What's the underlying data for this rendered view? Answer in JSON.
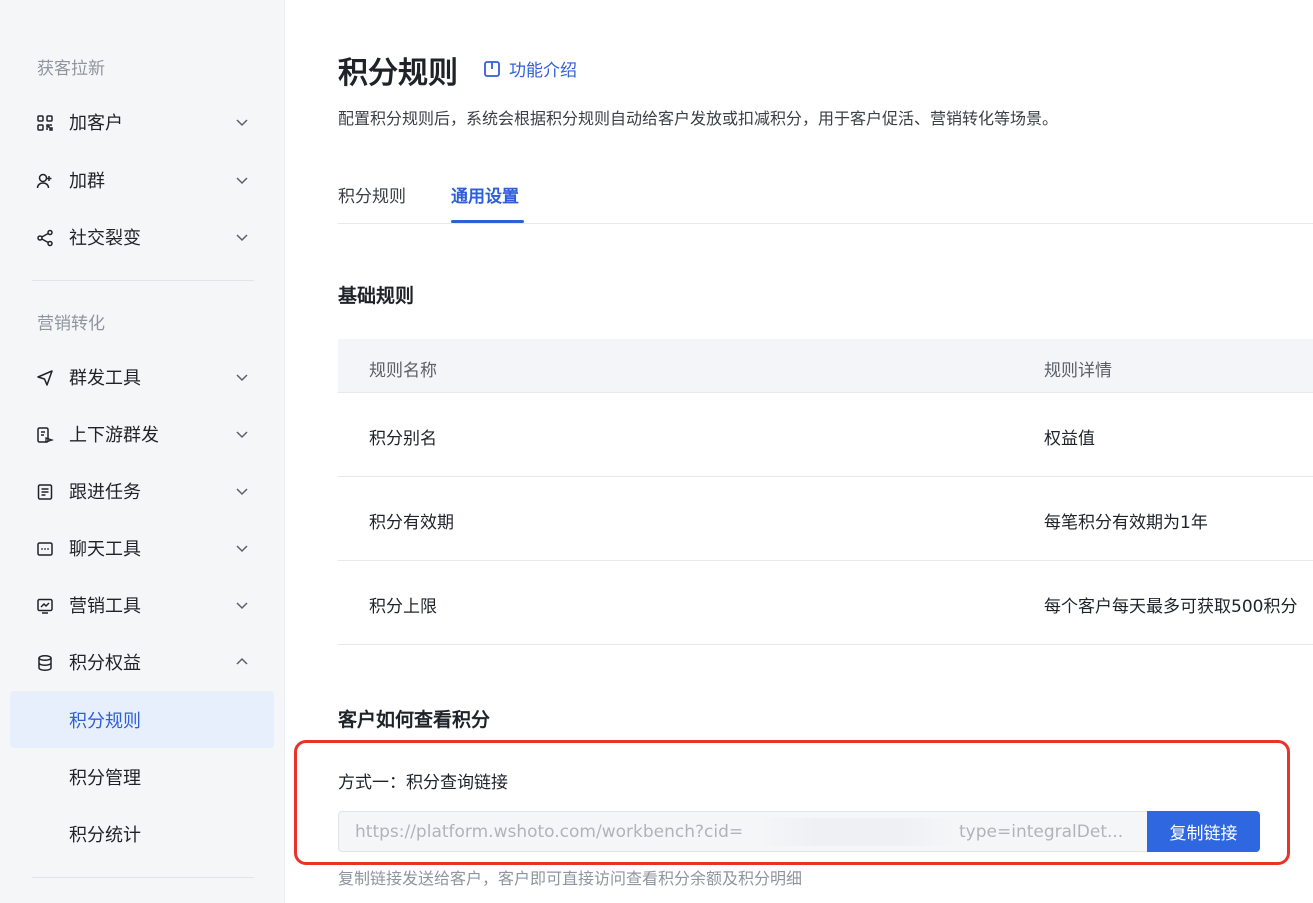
{
  "sidebar": {
    "section_acquire": "获客拉新",
    "section_marketing": "营销转化",
    "items": {
      "add_customer": "加客户",
      "add_group": "加群",
      "social_fission": "社交裂变",
      "mass_send": "群发工具",
      "upstream_send": "上下游群发",
      "follow_task": "跟进任务",
      "chat_tools": "聊天工具",
      "marketing_tools": "营销工具",
      "points_rights": "积分权益"
    },
    "sub_items": {
      "points_rules": "积分规则",
      "points_manage": "积分管理",
      "points_stats": "积分统计"
    }
  },
  "header": {
    "title": "积分规则",
    "intro_link": "功能介绍",
    "description": "配置积分规则后，系统会根据积分规则自动给客户发放或扣减积分，用于客户促活、营销转化等场景。"
  },
  "tabs": {
    "rules": "积分规则",
    "general": "通用设置"
  },
  "basic": {
    "heading": "基础规则",
    "columns": [
      "规则名称",
      "规则详情"
    ],
    "rows": [
      {
        "name": "积分别名",
        "detail": "权益值"
      },
      {
        "name": "积分有效期",
        "detail": "每笔积分有效期为1年"
      },
      {
        "name": "积分上限",
        "detail": "每个客户每天最多可获取500积分"
      }
    ]
  },
  "view": {
    "heading": "客户如何查看积分",
    "method_one": "方式一：积分查询链接",
    "link_prefix": "https://platform.wshoto.com/workbench?cid=",
    "link_suffix": "type=integralDet...",
    "copy_label": "复制链接",
    "hint": "复制链接发送给客户，客户即可直接访问查看积分余额及积分明细"
  },
  "colors": {
    "accent": "#2f5fd8",
    "button": "#2f67e0",
    "highlight": "#e8332a"
  }
}
